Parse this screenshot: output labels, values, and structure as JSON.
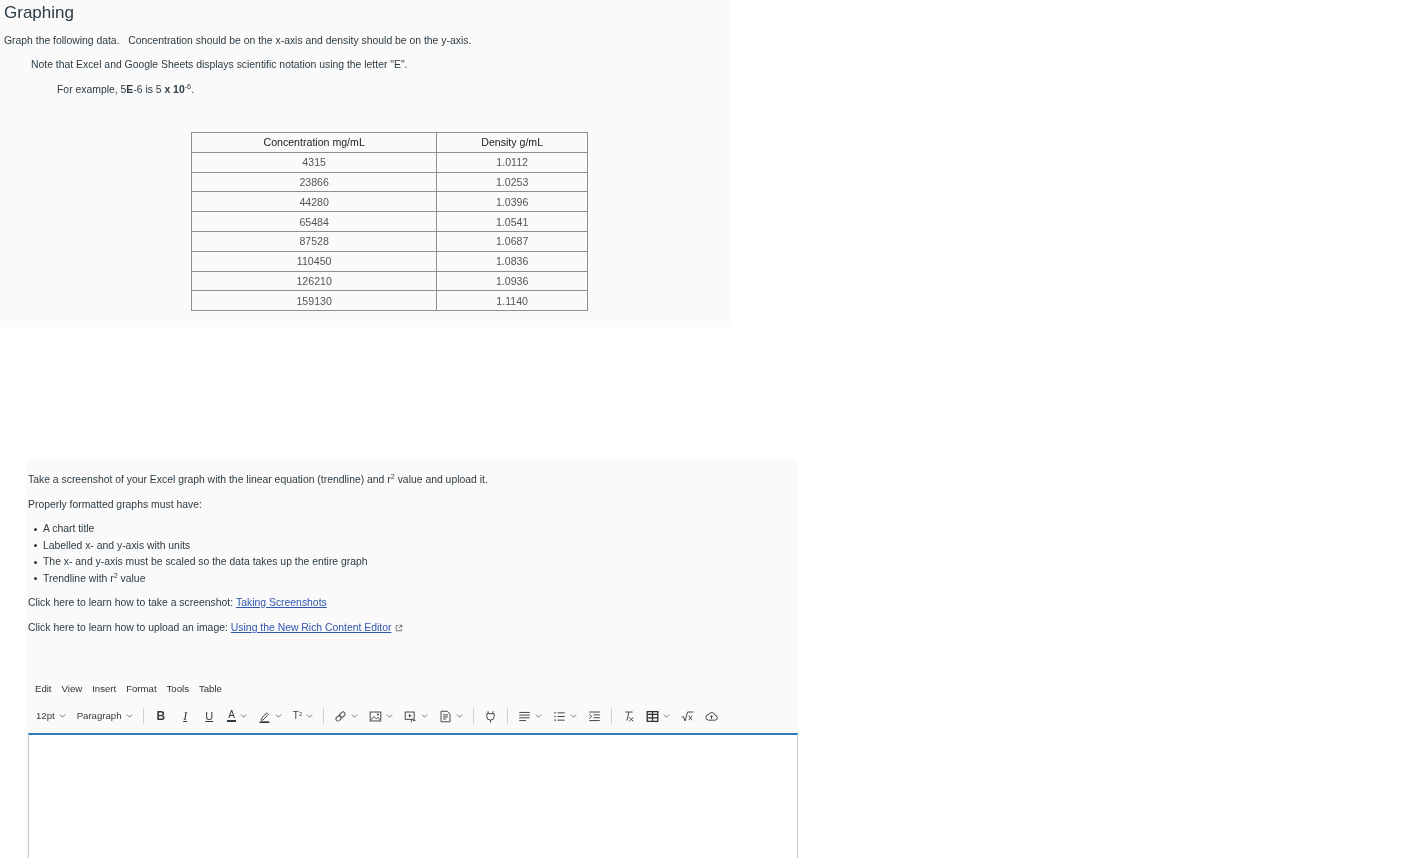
{
  "title": "Graphing",
  "intro": "Graph the following data.   Concentration should be on the x-axis and density should be on the y-axis.",
  "note": "Note that Excel and Google Sheets displays scientific notation using the letter \"E\".",
  "example": "For example, 5**E**-6 is 5 **x 10**$^{-6}$.",
  "table": {
    "columns": [
      "Concentration mg/mL",
      "Density g/mL"
    ],
    "rows": [
      [
        "4315",
        "1.0112"
      ],
      [
        "23866",
        "1.0253"
      ],
      [
        "44280",
        "1.0396"
      ],
      [
        "65484",
        "1.0541"
      ],
      [
        "87528",
        "1.0687"
      ],
      [
        "110450",
        "1.0836"
      ],
      [
        "126210",
        "1.0936"
      ],
      [
        "159130",
        "1.1140"
      ]
    ]
  },
  "assignment": {
    "instruction": "Take a screenshot of your Excel graph with the linear equation (trendline) and r$^{2}$ value and upload it.",
    "requirements_heading": "Properly formatted graphs must have:",
    "requirements": [
      "A chart title",
      "Labelled x- and y-axis with units",
      "The x- and y-axis must be scaled so the data takes up the entire graph",
      "Trendline with r$^{2}$ value"
    ],
    "help_links": [
      {
        "text": "Click here to learn how to take a screenshot:",
        "link": "Taking Screenshots",
        "external": false
      },
      {
        "text": "Click here to learn how to upload an image:",
        "link": "Using the New Rich Content Editor",
        "external": true
      }
    ]
  },
  "editor": {
    "menu": [
      "Edit",
      "View",
      "Insert",
      "Format",
      "Tools",
      "Table"
    ],
    "toolbar": [
      [
        {
          "kind": "font-size",
          "label": "12pt",
          "dropdown": true
        },
        {
          "kind": "block-format",
          "label": "Paragraph",
          "dropdown": true
        }
      ],
      [
        {
          "kind": "bold",
          "label": "B",
          "dropdown": false
        },
        {
          "kind": "italic",
          "label": "I",
          "dropdown": false
        },
        {
          "kind": "underline",
          "label": "U",
          "dropdown": false
        },
        {
          "kind": "text-color",
          "label": "A",
          "dropdown": true
        },
        {
          "kind": "highlight",
          "dropdown": true
        },
        {
          "kind": "superscript",
          "label": "T$^{2}$",
          "dropdown": true
        }
      ],
      [
        {
          "kind": "link",
          "dropdown": true
        },
        {
          "kind": "image",
          "dropdown": true
        },
        {
          "kind": "media",
          "dropdown": true
        },
        {
          "kind": "document",
          "dropdown": true
        }
      ],
      [
        {
          "kind": "plugin",
          "dropdown": false
        }
      ],
      [
        {
          "kind": "align",
          "dropdown": true
        },
        {
          "kind": "list",
          "dropdown": true
        },
        {
          "kind": "indent",
          "dropdown": false
        }
      ],
      [
        {
          "kind": "clear-format",
          "dropdown": false
        },
        {
          "kind": "table",
          "dropdown": true
        },
        {
          "kind": "equation",
          "dropdown": false
        },
        {
          "kind": "cloud",
          "dropdown": false
        }
      ]
    ]
  }
}
